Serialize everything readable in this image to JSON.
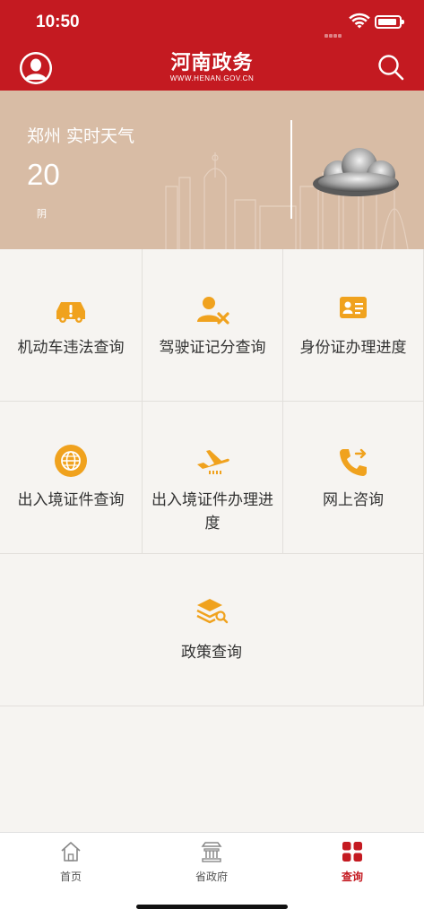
{
  "status_bar": {
    "time": "10:50"
  },
  "header": {
    "title": "河南政务",
    "subtitle": "WWW.HENAN.GOV.CN"
  },
  "weather": {
    "city": "郑州  实时天气",
    "temperature": "20",
    "condition": "阴"
  },
  "services": [
    {
      "label": "机动车违法查询",
      "icon": "car-alert-icon"
    },
    {
      "label": "驾驶证记分查询",
      "icon": "user-remove-icon"
    },
    {
      "label": "身份证办理进度",
      "icon": "id-card-icon"
    },
    {
      "label": "出入境证件查询",
      "icon": "globe-icon"
    },
    {
      "label": "出入境证件办理进度",
      "icon": "airplane-icon"
    },
    {
      "label": "网上咨询",
      "icon": "phone-forward-icon"
    },
    {
      "label": "政策查询",
      "icon": "layers-search-icon"
    }
  ],
  "tabbar": {
    "tabs": [
      {
        "label": "首页",
        "icon": "home-icon"
      },
      {
        "label": "省政府",
        "icon": "government-building-icon"
      },
      {
        "label": "查询",
        "icon": "grid-icon"
      }
    ],
    "active_index": 2
  },
  "colors": {
    "brand_red": "#c41a21",
    "accent_orange": "#f0a21e",
    "weather_bg": "#d8bca5"
  }
}
